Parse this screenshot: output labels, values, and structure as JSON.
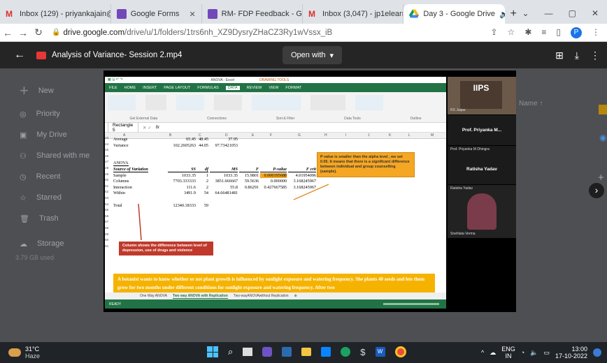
{
  "tabs": [
    {
      "title": "Inbox (129) - priyankajain@",
      "icon": "gmail-icon",
      "active": false
    },
    {
      "title": "Google Forms",
      "icon": "forms-icon",
      "active": false
    },
    {
      "title": "RM- FDP Feedback - Google",
      "icon": "forms-icon",
      "active": false
    },
    {
      "title": "Inbox (3,047) - jp1elearn@",
      "icon": "gmail-icon",
      "active": false
    },
    {
      "title": "Day 3 - Google Drive",
      "icon": "drive-icon",
      "active": true
    }
  ],
  "new_tab": "+",
  "address": {
    "host": "drive.google.com",
    "path": "/drive/u/1/folders/1trs6nh_XZ9DysryZHaCZ3Ry1wVssx_iB"
  },
  "viewer": {
    "file_title": "Analysis of Variance- Session 2.mp4",
    "open_with": "Open with"
  },
  "drive_sidebar": [
    {
      "label": "New",
      "icon": "plus-icon"
    },
    {
      "label": "Priority",
      "icon": "check-circle-icon"
    },
    {
      "label": "My Drive",
      "icon": "drive-folder-icon"
    },
    {
      "label": "Shared with me",
      "icon": "people-icon"
    },
    {
      "label": "Recent",
      "icon": "clock-icon"
    },
    {
      "label": "Starred",
      "icon": "star-icon"
    },
    {
      "label": "Trash",
      "icon": "trash-icon"
    },
    {
      "label": "Storage",
      "icon": "cloud-icon"
    },
    {
      "label": "3.79 GB used",
      "icon": ""
    }
  ],
  "drive_right_label": "Name",
  "excel": {
    "title": "ANOVA - Excel",
    "drawing_tools": "DRAWING TOOLS",
    "ribbon_tabs": [
      "FILE",
      "HOME",
      "INSERT",
      "PAGE LAYOUT",
      "FORMULAS",
      "DATA",
      "REVIEW",
      "VIEW",
      "FORMAT"
    ],
    "active_ribbon_tab": "DATA",
    "ribbon_groups": [
      "Get External Data",
      "Connections",
      "Sort & Filter",
      "Data Tools",
      "Outline"
    ],
    "namebox": "Rectangle 5",
    "fx": "fx",
    "columns": [
      "A",
      "B",
      "C",
      "D",
      "E",
      "F",
      "G",
      "H",
      "I",
      "J",
      "K",
      "L",
      "M",
      "N"
    ],
    "rows": [
      {
        "n": "43",
        "a": "Average",
        "b": "65.45",
        "c": "48.45",
        "d": "37.95"
      },
      {
        "n": "44",
        "a": "Variance",
        "b": "102.2605263",
        "c": "44.05",
        "d": "97.73421053"
      },
      {
        "n": "45"
      },
      {
        "n": "46"
      },
      {
        "n": "47",
        "a": "ANOVA"
      },
      {
        "n": "48",
        "a": "Source of Variation",
        "b": "SS",
        "c": "df",
        "d": "MS",
        "e": "F",
        "f": "P-value",
        "g": "F crit"
      },
      {
        "n": "49",
        "a": "Sample",
        "b": "1033.35",
        "c": "1",
        "d": "1033.35",
        "e": "15.9801",
        "f": "0.000195688",
        "g": "4.01954096"
      },
      {
        "n": "50",
        "a": "Columns",
        "b": "7703.333333",
        "c": "2",
        "d": "3851.666667",
        "e": "59.5636",
        "f": "0.000000",
        "g": "3.168245967"
      },
      {
        "n": "51",
        "a": "Interaction",
        "b": "111.6",
        "c": "2",
        "d": "55.8",
        "e": "0.86291",
        "f": "0.427667585",
        "g": "3.168245967"
      },
      {
        "n": "52",
        "a": "Within",
        "b": "3491.9",
        "c": "54",
        "d": "64.66481481"
      },
      {
        "n": "53"
      },
      {
        "n": "54",
        "a": "Total",
        "b": "12340.18333",
        "c": "59"
      },
      {
        "n": "55"
      },
      {
        "n": "56"
      },
      {
        "n": "57"
      },
      {
        "n": "58"
      },
      {
        "n": "59"
      },
      {
        "n": "60"
      },
      {
        "n": "61"
      }
    ],
    "note_pvalue": "P value is smaller than the alpha level , we set 0.05. It means that there is a significant difference between individual and group counselling (sample).",
    "note_columns": "Column shows the difference between level of depression, use of drugs and violence",
    "footer_text": "A botanist wants to know whether or not plant growth is influenced by sunlight exposure and watering frequency. She plants 40 seeds and lets them grow for two months under different conditions for sunlight exposure and watering frequency. After two",
    "sheets": [
      "One Way ANOVA",
      "Two way ANOVA with Replication",
      "Two-wayANOVAwithout Replication"
    ],
    "active_sheet": "Two way ANOVA with Replication",
    "status": "READY"
  },
  "participants": [
    {
      "name": "RS Jaipur",
      "big": ""
    },
    {
      "name": "",
      "big": "Prof. Priyanka M..."
    },
    {
      "name": "Prof. Priyanka M Dhingra",
      "big": ""
    },
    {
      "name": "",
      "big": "Ratisha Yadav"
    },
    {
      "name": "Ratisha Yadav",
      "big": ""
    },
    {
      "name": "Snehlata Verma",
      "big": ""
    }
  ],
  "weather": {
    "temp": "31°C",
    "cond": "Haze"
  },
  "tray": {
    "lang": "ENG",
    "region": "IN",
    "time": "13:00",
    "date": "17-10-2022"
  }
}
